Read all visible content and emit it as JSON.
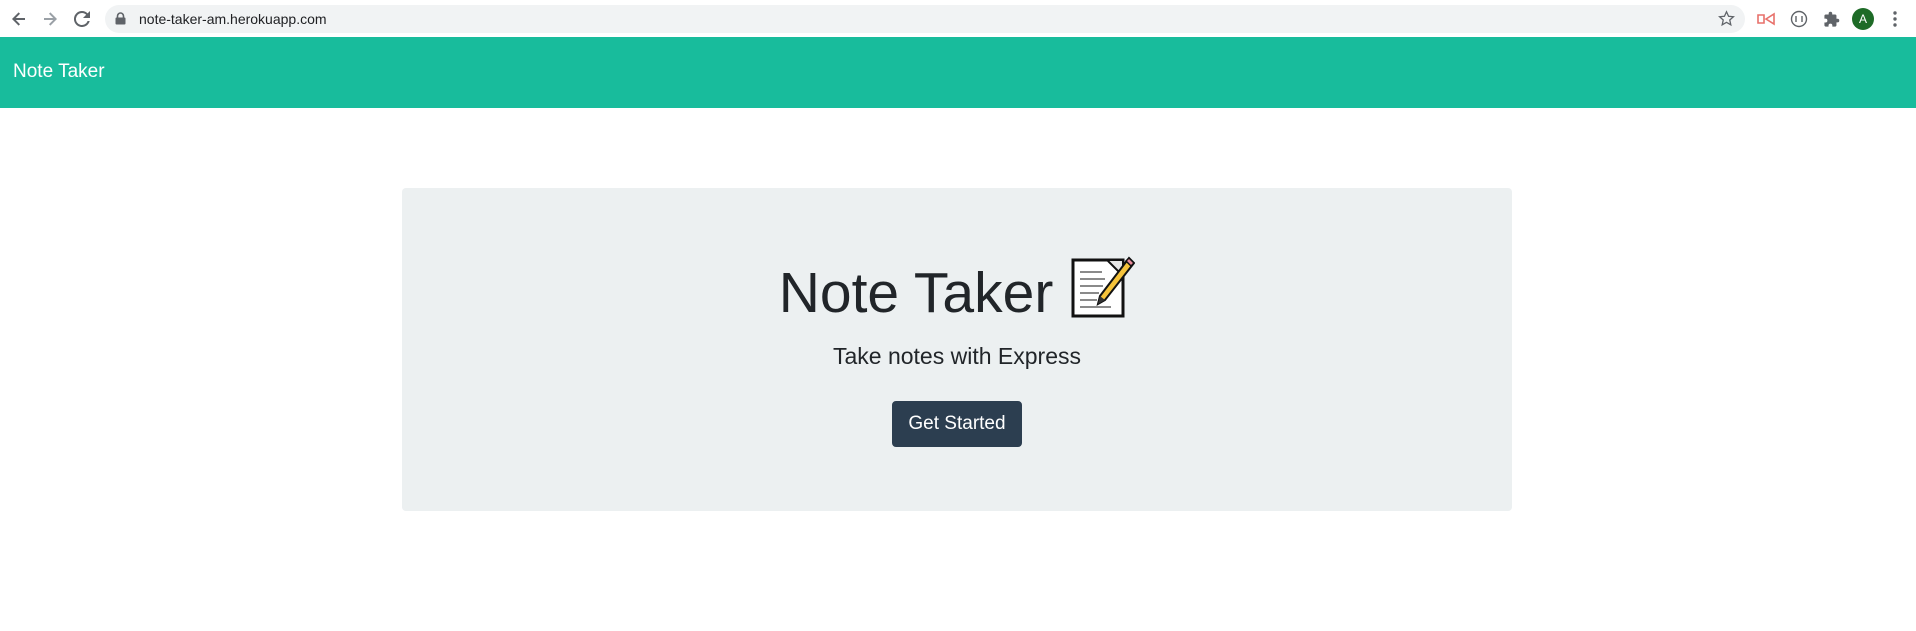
{
  "browser": {
    "url": "note-taker-am.herokuapp.com",
    "avatar_initial": "A"
  },
  "navbar": {
    "brand": "Note Taker",
    "color": "#18bc9c"
  },
  "hero": {
    "title": "Note Taker",
    "title_icon": "memo-icon",
    "subtitle": "Take notes with Express",
    "button_label": "Get Started",
    "background": "#ecf0f1",
    "button_color": "#2c3e50"
  }
}
